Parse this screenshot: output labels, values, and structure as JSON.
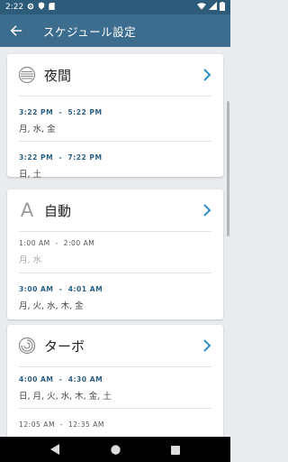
{
  "status_bar": {
    "time": "2:22"
  },
  "app_bar": {
    "title": "スケジュール設定"
  },
  "modes": [
    {
      "name": "夜間",
      "icon": "night-mode-icon",
      "schedules": [
        {
          "time": "3:22 PM  -  5:22 PM",
          "days": "月, 水, 金",
          "active": true
        },
        {
          "time": "3:22 PM  -  7:22 PM",
          "days": "日, 土",
          "active": true
        }
      ]
    },
    {
      "name": "自動",
      "icon": "auto-mode-icon",
      "icon_glyph": "A",
      "schedules": [
        {
          "time": "1:00 AM  -  2:00 AM",
          "days": "月, 水",
          "active": false
        },
        {
          "time": "3:00 AM  -  4:01 AM",
          "days": "月, 火, 水, 木, 金",
          "active": true
        }
      ]
    },
    {
      "name": "ターボ",
      "icon": "turbo-mode-icon",
      "schedules": [
        {
          "time": "4:00 AM  -  4:30 AM",
          "days": "日, 月, 火, 水, 木, 金, 土",
          "active": true
        },
        {
          "time": "12:05 AM  -  12:35 AM",
          "days": "",
          "active": false
        }
      ]
    }
  ],
  "colors": {
    "app_bar": "#3c6d8f",
    "status_bar": "#2d5c7b",
    "accent": "#2d8fc8",
    "active_time": "#2b5f82"
  }
}
